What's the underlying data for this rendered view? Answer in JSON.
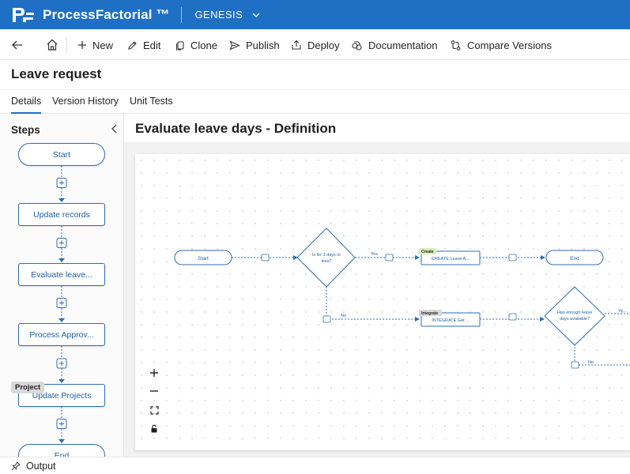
{
  "app": {
    "brand": "ProcessFactorial ™",
    "environment": "GENESIS",
    "colors": {
      "accent": "#1f6fc5",
      "node_border": "#2f6eb5",
      "node_text": "#1e5fa8"
    }
  },
  "toolbar": {
    "back_icon": "arrow-left-icon",
    "home_icon": "home-icon",
    "new_label": "New",
    "edit_label": "Edit",
    "clone_label": "Clone",
    "publish_label": "Publish",
    "deploy_label": "Deploy",
    "documentation_label": "Documentation",
    "compare_label": "Compare Versions"
  },
  "page": {
    "title": "Leave request",
    "tabs": [
      {
        "label": "Details",
        "active": true
      },
      {
        "label": "Version History",
        "active": false
      },
      {
        "label": "Unit Tests",
        "active": false
      }
    ]
  },
  "steps": {
    "title": "Steps",
    "items": [
      {
        "label": "Start",
        "shape": "pill"
      },
      {
        "label": "Update records",
        "shape": "rect"
      },
      {
        "label": "Evaluate leave...",
        "shape": "rect"
      },
      {
        "label": "Process Approv...",
        "shape": "rect"
      },
      {
        "label": "Update Projects",
        "shape": "rect",
        "tag": "Project"
      },
      {
        "label": "End",
        "shape": "pill"
      }
    ]
  },
  "canvas": {
    "title": "Evaluate leave days - Definition",
    "nodes": {
      "start": "Start",
      "decision1": [
        "Is for 3 days or",
        "less?"
      ],
      "create_tag": "Create",
      "create_node": "CREATE Leave A...",
      "end": "End",
      "integrate_tag": "Integrate",
      "integrate_node": "INTEGRATE Get ...",
      "decision2": [
        "Has enough leave",
        "days available?"
      ]
    },
    "edge_labels": {
      "yes": "Yes",
      "no": "No",
      "yes_cut": "Ye..."
    },
    "controls": {
      "zoom_in_icon": "plus-icon",
      "zoom_out_icon": "minus-icon",
      "fit_icon": "fit-view-icon",
      "lock_icon": "lock-icon"
    }
  },
  "output": {
    "label": "Output"
  }
}
